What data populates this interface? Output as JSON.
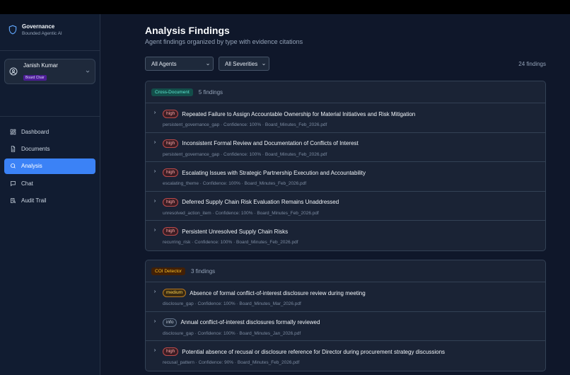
{
  "brand": {
    "title": "Governance",
    "subtitle": "Bounded Agentic AI"
  },
  "user": {
    "name": "Janish Kumar",
    "role": "Board Chair"
  },
  "nav": [
    {
      "label": "Dashboard",
      "icon": "dashboard-icon",
      "active": false
    },
    {
      "label": "Documents",
      "icon": "document-icon",
      "active": false
    },
    {
      "label": "Analysis",
      "icon": "search-icon",
      "active": true
    },
    {
      "label": "Chat",
      "icon": "chat-icon",
      "active": false
    },
    {
      "label": "Audit Trail",
      "icon": "audit-icon",
      "active": false
    }
  ],
  "page": {
    "title": "Analysis Findings",
    "subtitle": "Agent findings organized by type with evidence citations"
  },
  "filters": {
    "agent": "All Agents",
    "severity": "All Severities"
  },
  "total_count": "24 findings",
  "groups": [
    {
      "agent": "Cross-Document",
      "count": "5 findings",
      "findings": [
        {
          "severity": "high",
          "title": "Repeated Failure to Assign Accountable Ownership for Material Initiatives and Risk Mitigation",
          "meta": "persistent_governance_gap · Confidence: 100% · Board_Minutes_Feb_2026.pdf"
        },
        {
          "severity": "high",
          "title": "Inconsistent Formal Review and Documentation of Conflicts of Interest",
          "meta": "persistent_governance_gap · Confidence: 100% · Board_Minutes_Feb_2026.pdf"
        },
        {
          "severity": "high",
          "title": "Escalating Issues with Strategic Partnership Execution and Accountability",
          "meta": "escalating_theme · Confidence: 100% · Board_Minutes_Feb_2026.pdf"
        },
        {
          "severity": "high",
          "title": "Deferred Supply Chain Risk Evaluation Remains Unaddressed",
          "meta": "unresolved_action_item · Confidence: 100% · Board_Minutes_Feb_2026.pdf"
        },
        {
          "severity": "high",
          "title": "Persistent Unresolved Supply Chain Risks",
          "meta": "recurring_risk · Confidence: 100% · Board_Minutes_Feb_2026.pdf"
        }
      ]
    },
    {
      "agent": "COI Detector",
      "count": "3 findings",
      "findings": [
        {
          "severity": "medium",
          "title": "Absence of formal conflict-of-interest disclosure review during meeting",
          "meta": "disclosure_gap · Confidence: 100% · Board_Minutes_Mar_2026.pdf"
        },
        {
          "severity": "info",
          "title": "Annual conflict-of-interest disclosures formally reviewed",
          "meta": "disclosure_gap · Confidence: 100% · Board_Minutes_Jan_2026.pdf"
        },
        {
          "severity": "high",
          "title": "Potential absence of recusal or disclosure reference for Director during procurement strategy discussions",
          "meta": "recusal_pattern · Confidence: 90% · Board_Minutes_Feb_2026.pdf"
        }
      ]
    }
  ]
}
